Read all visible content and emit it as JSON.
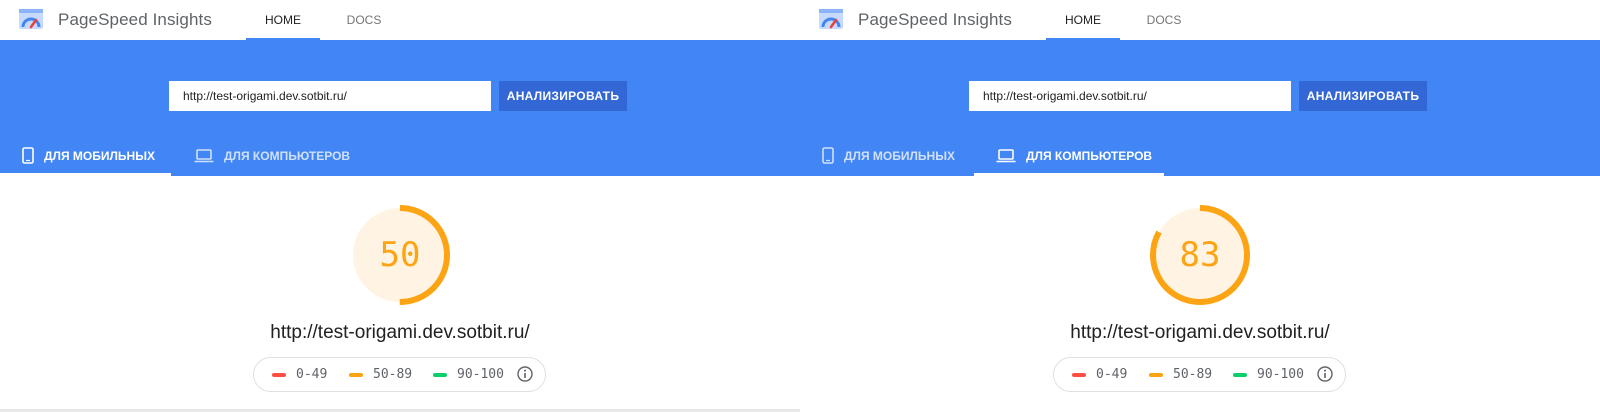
{
  "brand": "PageSpeed Insights",
  "nav": {
    "home": "HOME",
    "docs": "DOCS"
  },
  "colors": {
    "band": "#4285f4",
    "button": "#3367d6",
    "average": "#fca413",
    "bad": "#ff4e42",
    "good": "#0cce6b"
  },
  "panels": [
    {
      "url_input": "http://test-origami.dev.sotbit.ru/",
      "analyze_label": "АНАЛИЗИРОВАТЬ",
      "tab_mobile": "ДЛЯ МОБИЛЬНЫХ",
      "tab_desktop": "ДЛЯ КОМПЬЮТЕРОВ",
      "active_tab": "mobile",
      "score": "50",
      "analyzed_url": "http://test-origami.dev.sotbit.ru/",
      "legend": {
        "bad": "0-49",
        "average": "50-89",
        "good": "90-100"
      }
    },
    {
      "url_input": "http://test-origami.dev.sotbit.ru/",
      "analyze_label": "АНАЛИЗИРОВАТЬ",
      "tab_mobile": "ДЛЯ МОБИЛЬНЫХ",
      "tab_desktop": "ДЛЯ КОМПЬЮТЕРОВ",
      "active_tab": "desktop",
      "score": "83",
      "analyzed_url": "http://test-origami.dev.sotbit.ru/",
      "legend": {
        "bad": "0-49",
        "average": "50-89",
        "good": "90-100"
      }
    }
  ]
}
